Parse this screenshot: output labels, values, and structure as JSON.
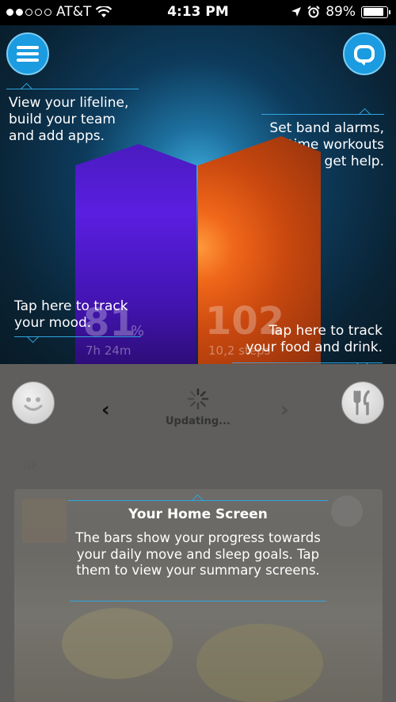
{
  "status_bar": {
    "carrier": "AT&T",
    "time": "4:13 PM",
    "battery_percent": "89%",
    "battery_level": 0.89,
    "signal_dots_filled": 2,
    "signal_dots_total": 5,
    "icons": [
      "wifi-icon",
      "location-arrow-icon",
      "alarm-icon",
      "battery-icon"
    ]
  },
  "header": {
    "menu_icon": "hamburger-menu-icon",
    "chat_icon": "chat-bubble-icon"
  },
  "tooltips": {
    "lifeline": "View your lifeline,\nbuild your team\nand add apps.",
    "alarms": "Set band alarms,\ntime workouts\nand get help.",
    "mood": "Tap here to track\nyour mood.",
    "food": "Tap here to track\nyour food and drink."
  },
  "bars": {
    "sleep": {
      "percent": "81",
      "unit": "%",
      "sub": "7h 24m",
      "color": "#4a1bbf"
    },
    "move": {
      "percent": "102",
      "sub": "10,2",
      "sub_suffix": "steps",
      "color": "#f0671a"
    }
  },
  "panel": {
    "updating_label": "Updating...",
    "mood_icon": "smiley-face-icon",
    "food_icon": "fork-knife-icon",
    "prev_icon": "chevron-left-icon",
    "next_icon": "chevron-right-icon",
    "faded_label": "UP"
  },
  "home_tip": {
    "title": "Your Home Screen",
    "body": "The bars show your progress towards your daily move and sleep goals. Tap them to view your summary screens."
  },
  "colors": {
    "accent_blue": "#1b9be0",
    "tip_line": "#2fa6de",
    "panel_gray": "#5f5e5c"
  }
}
